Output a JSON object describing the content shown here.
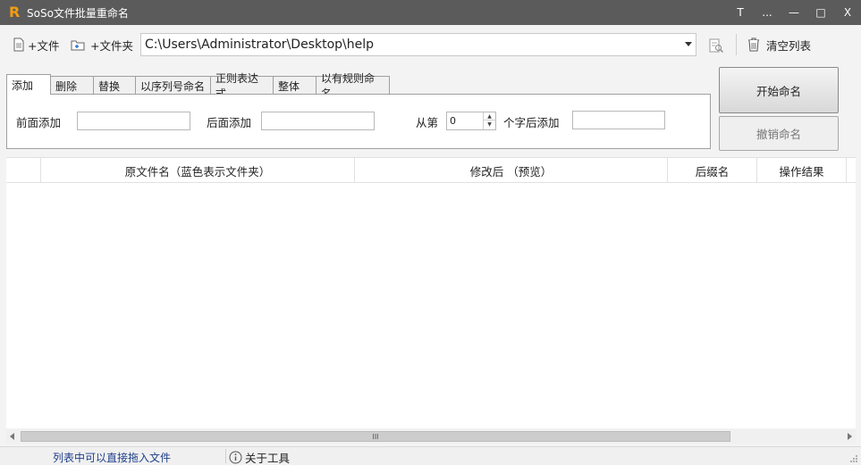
{
  "window": {
    "title": "SoSo文件批量重命名",
    "logo": "R",
    "buttons": [
      "T",
      "...",
      "—",
      "□",
      "X"
    ]
  },
  "toolbar": {
    "add_file": "+文件",
    "add_folder": "+文件夹",
    "path_value": "C:\\Users\\Administrator\\Desktop\\help",
    "clear_list": "清空列表"
  },
  "tabs": [
    "添加",
    "删除",
    "替换",
    "以序列号命名",
    "正则表达式",
    "整体",
    "以有规则命名"
  ],
  "add_panel": {
    "prefix_label": "前面添加",
    "suffix_label": "后面添加",
    "from_label": "从第",
    "position_value": "0",
    "after_label": "个字后添加"
  },
  "actions": {
    "start": "开始命名",
    "undo": "撤销命名"
  },
  "table": {
    "columns": [
      "原文件名（蓝色表示文件夹）",
      "修改后 （预览）",
      "后缀名",
      "操作结果"
    ]
  },
  "scrollbar": {
    "thumb_grip": "III"
  },
  "status": {
    "hint": "列表中可以直接拖入文件",
    "about": "关于工具"
  },
  "colors": {
    "titlebar": "#5b5b5b",
    "logo": "#f39c12",
    "status_hint": "#1f3f8a"
  }
}
